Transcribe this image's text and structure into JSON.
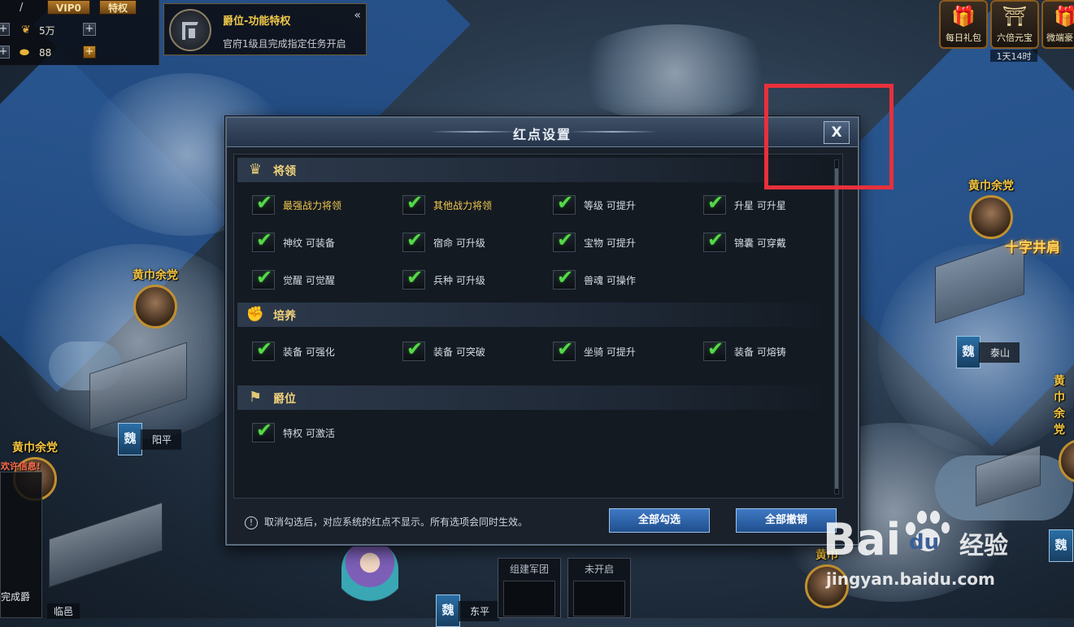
{
  "topbar": {
    "vip": "VIP0",
    "privilege": "特权",
    "resources": [
      {
        "icon": "wood-icon",
        "value": "5万"
      },
      {
        "icon": "gold-ingot-icon",
        "value": "88"
      }
    ]
  },
  "peerage_banner": {
    "title": "爵位-功能特权",
    "desc": "官府1级且完成指定任务开启"
  },
  "top_right": {
    "icons": [
      {
        "name": "daily-gift",
        "label": "每日礼包"
      },
      {
        "name": "sixfold-yuanbao",
        "label": "六倍元宝"
      },
      {
        "name": "weiduan",
        "label": "微端豪"
      }
    ],
    "timer": "1天14时"
  },
  "map": {
    "rebels": [
      "黄巾余党",
      "黄巾余党",
      "黄巾余党",
      "黄巾余党",
      "黄巾"
    ],
    "cities": [
      {
        "faction": "魏",
        "name": "阳平"
      },
      {
        "faction": "魏",
        "name": "泰山"
      },
      {
        "faction": "魏",
        "name": "东平"
      },
      {
        "faction": "魏",
        "name": ""
      }
    ],
    "left_panel_alert": "欢许信息!",
    "left_panel_text": "完成爵",
    "left_bottom_city": "临邑",
    "bottom_slots": [
      "组建军团",
      "未开启"
    ],
    "event_banner": "十字井肩"
  },
  "dialog": {
    "title": "红点设置",
    "close_label": "X",
    "sections": [
      {
        "name": "将领",
        "options": [
          {
            "label": "最强战力将领",
            "checked": true,
            "highlight": true
          },
          {
            "label": "其他战力将领",
            "checked": true,
            "highlight": true
          },
          {
            "label": "等级  可提升",
            "checked": true
          },
          {
            "label": "升星  可升星",
            "checked": true
          },
          {
            "label": "神纹  可装备",
            "checked": true
          },
          {
            "label": "宿命  可升级",
            "checked": true
          },
          {
            "label": "宝物  可提升",
            "checked": true
          },
          {
            "label": "锦囊  可穿戴",
            "checked": true
          },
          {
            "label": "觉醒  可觉醒",
            "checked": true
          },
          {
            "label": "兵种  可升级",
            "checked": true
          },
          {
            "label": "兽魂  可操作",
            "checked": true
          }
        ]
      },
      {
        "name": "培养",
        "options": [
          {
            "label": "装备  可强化",
            "checked": true
          },
          {
            "label": "装备  可突破",
            "checked": true
          },
          {
            "label": "坐骑  可提升",
            "checked": true
          },
          {
            "label": "装备  可熔铸",
            "checked": true
          }
        ]
      },
      {
        "name": "爵位",
        "options": [
          {
            "label": "特权  可激活",
            "checked": true
          }
        ]
      }
    ],
    "note": "取消勾选后，对应系统的红点不显示。所有选项会同时生效。",
    "select_all": "全部勾选",
    "deselect_all": "全部撤销"
  },
  "watermark": {
    "brand": "Bai",
    "brand2": "du",
    "jingyan": "经验",
    "url": "jingyan.baidu.com"
  },
  "colors": {
    "highlight_box": "#e8303b",
    "check": "#56d84a",
    "gold_text": "#f2c94c",
    "button_blue": "#2f66ad"
  }
}
